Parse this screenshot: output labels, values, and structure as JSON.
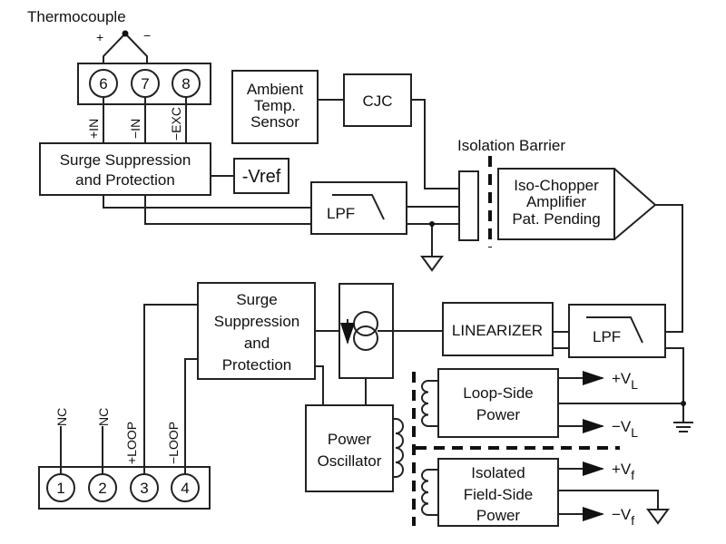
{
  "thermocouple": {
    "label": "Thermocouple",
    "plus": "+",
    "minus": "−"
  },
  "input_terminals": [
    {
      "number": "6",
      "label": "+IN"
    },
    {
      "number": "7",
      "label": "−IN"
    },
    {
      "number": "8",
      "label": "−EXC"
    }
  ],
  "surge_top": {
    "line1": "Surge Suppression",
    "line2": "and Protection"
  },
  "vref": "-Vref",
  "ambient": {
    "line1": "Ambient",
    "line2": "Temp.",
    "line3": "Sensor"
  },
  "cjc": "CJC",
  "lpf_label": "LPF",
  "isolation_barrier": "Isolation Barrier",
  "amplifier": {
    "line1": "Iso-Chopper",
    "line2": "Amplifier",
    "line3": "Pat. Pending"
  },
  "surge_bottom": {
    "line1": "Surge",
    "line2": "Suppression",
    "line3": "and",
    "line4": "Protection"
  },
  "linearizer": "LINEARIZER",
  "loop_power": {
    "line1": "Loop-Side",
    "line2": "Power",
    "plus": "+V",
    "minus": "−V",
    "sub": "L"
  },
  "field_power": {
    "line1": "Isolated",
    "line2": "Field-Side",
    "line3": "Power",
    "plus": "+V",
    "minus": "−V",
    "sub": "f"
  },
  "oscillator": {
    "line1": "Power",
    "line2": "Oscillator"
  },
  "output_terminals": [
    {
      "number": "1",
      "label": "NC"
    },
    {
      "number": "2",
      "label": "NC"
    },
    {
      "number": "3",
      "label": "+LOOP"
    },
    {
      "number": "4",
      "label": "−LOOP"
    }
  ]
}
